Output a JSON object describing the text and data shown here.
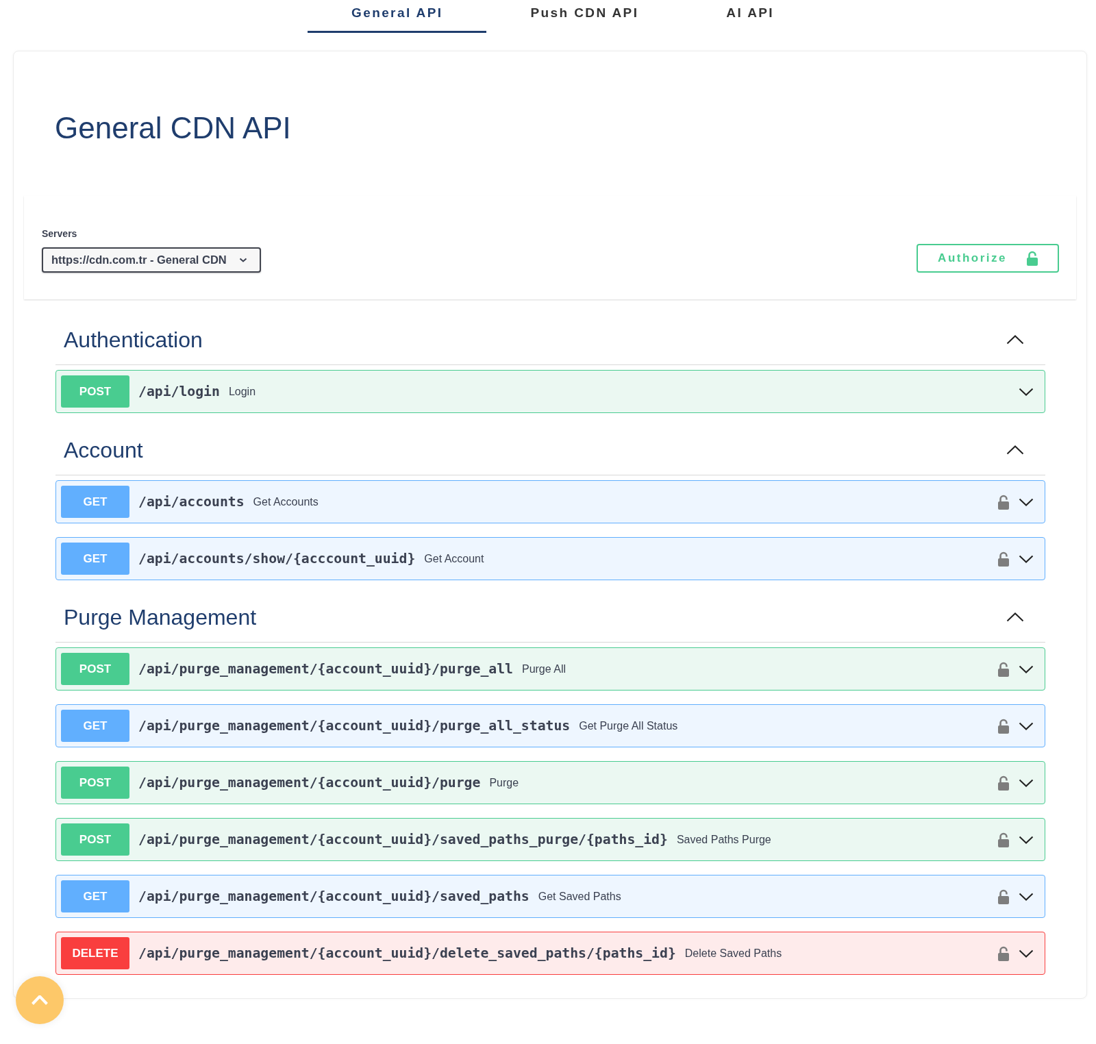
{
  "tabs": [
    {
      "label": "General API",
      "selected": true
    },
    {
      "label": "Push CDN API",
      "selected": false
    },
    {
      "label": "AI API",
      "selected": false
    }
  ],
  "title": "General CDN API",
  "servers": {
    "label": "Servers",
    "value": "https://cdn.com.tr - General CDN"
  },
  "authorize_button": "Authorize",
  "sections": [
    {
      "name": "Authentication",
      "expanded": true,
      "operations": [
        {
          "kind": "post",
          "method": "POST",
          "path": "/api/login",
          "summary": "Login",
          "secured": false,
          "expanded": false
        }
      ]
    },
    {
      "name": "Account",
      "expanded": true,
      "operations": [
        {
          "kind": "get",
          "method": "GET",
          "path": "/api/accounts",
          "summary": "Get Accounts",
          "secured": true,
          "expanded": false
        },
        {
          "kind": "get",
          "method": "GET",
          "path": "/api/accounts/show/{acccount_uuid}",
          "summary": "Get Account",
          "secured": true,
          "expanded": false
        }
      ]
    },
    {
      "name": "Purge Management",
      "expanded": true,
      "operations": [
        {
          "kind": "post",
          "method": "POST",
          "path": "/api/purge_management/{account_uuid}/purge_all",
          "summary": "Purge All",
          "secured": true,
          "expanded": false
        },
        {
          "kind": "get",
          "method": "GET",
          "path": "/api/purge_management/{account_uuid}/purge_all_status",
          "summary": "Get Purge All Status",
          "secured": true,
          "expanded": false
        },
        {
          "kind": "post",
          "method": "POST",
          "path": "/api/purge_management/{account_uuid}/purge",
          "summary": "Purge",
          "secured": true,
          "expanded": false
        },
        {
          "kind": "post",
          "method": "POST",
          "path": "/api/purge_management/{account_uuid}/saved_paths_purge/{paths_id}",
          "summary": "Saved Paths Purge",
          "secured": true,
          "expanded": false
        },
        {
          "kind": "get",
          "method": "GET",
          "path": "/api/purge_management/{account_uuid}/saved_paths",
          "summary": "Get Saved Paths",
          "secured": true,
          "expanded": false
        },
        {
          "kind": "delete",
          "method": "DELETE",
          "path": "/api/purge_management/{account_uuid}/delete_saved_paths/{paths_id}",
          "summary": "Delete Saved Paths",
          "secured": true,
          "expanded": false
        }
      ]
    }
  ]
}
